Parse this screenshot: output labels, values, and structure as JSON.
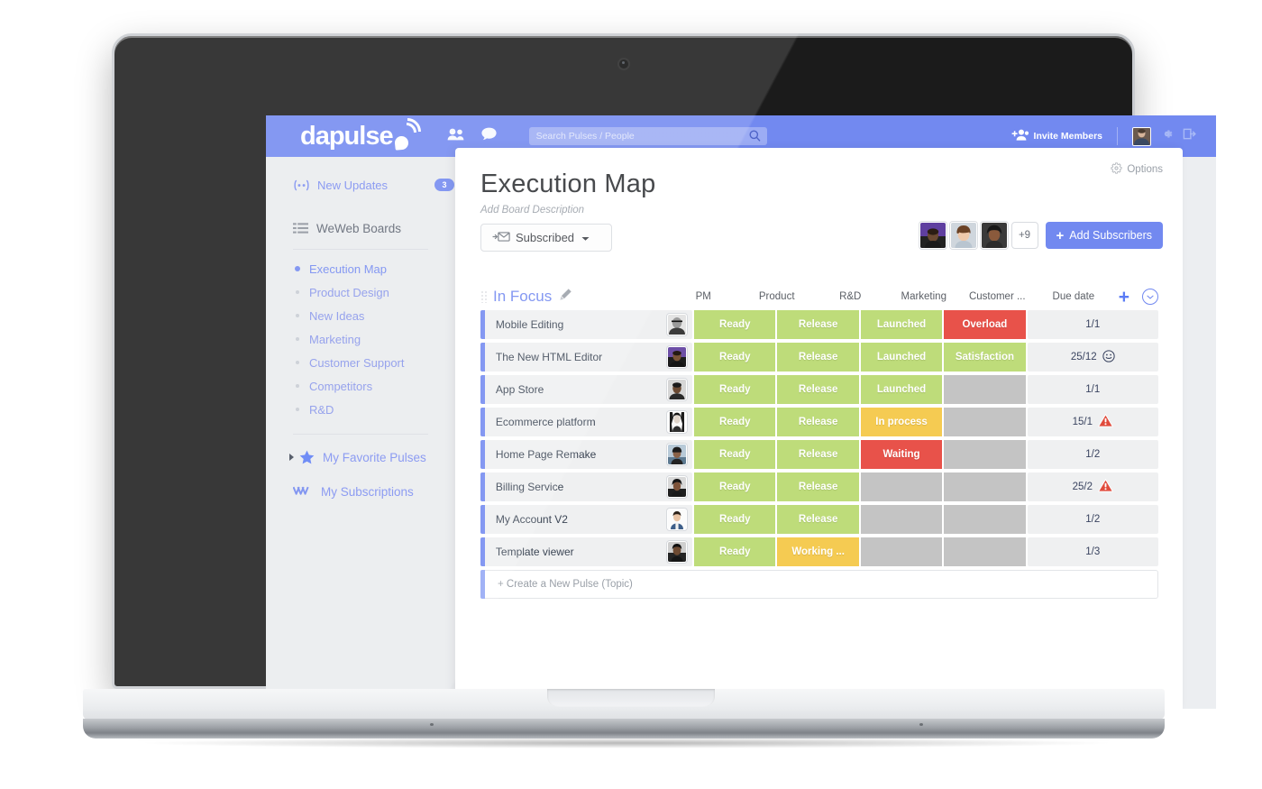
{
  "app": {
    "brand": "dapulse",
    "topbar": {
      "search_placeholder": "Search Pulses / People",
      "invite_label": "Invite Members",
      "icons": [
        "people-icon",
        "chat-icon",
        "search-icon",
        "gear-icon",
        "logout-icon"
      ]
    }
  },
  "sidebar": {
    "new_updates": {
      "label": "New Updates",
      "badge": "3"
    },
    "boards_header": "WeWeb Boards",
    "boards": [
      {
        "label": "Execution Map",
        "active": true
      },
      {
        "label": "Product Design",
        "active": false
      },
      {
        "label": "New Ideas",
        "active": false
      },
      {
        "label": "Marketing",
        "active": false
      },
      {
        "label": "Customer Support",
        "active": false
      },
      {
        "label": "Competitors",
        "active": false
      },
      {
        "label": "R&D",
        "active": false
      }
    ],
    "favorites_label": "My Favorite Pulses",
    "subscriptions_label": "My Subscriptions"
  },
  "board": {
    "options_label": "Options",
    "title": "Execution Map",
    "description_placeholder": "Add Board Description",
    "subscribed_label": "Subscribed",
    "subscriber_overflow": "+9",
    "add_subscribers_label": "Add Subscribers",
    "group_name": "In Focus",
    "new_pulse_label": "+ Create a New Pulse (Topic)",
    "columns": [
      "PM",
      "Product",
      "R&D",
      "Marketing",
      "Customer ...",
      "Due date"
    ],
    "rows": [
      {
        "name": "Mobile Editing",
        "product": "Ready",
        "rd": "Release",
        "marketing": "Launched",
        "customer": "Overload",
        "due": "1/1",
        "due_icon": ""
      },
      {
        "name": "The New HTML Editor",
        "product": "Ready",
        "rd": "Release",
        "marketing": "Launched",
        "customer": "Satisfaction",
        "due": "25/12",
        "due_icon": "smiley-icon"
      },
      {
        "name": "App Store",
        "product": "Ready",
        "rd": "Release",
        "marketing": "Launched",
        "customer": "",
        "due": "1/1",
        "due_icon": ""
      },
      {
        "name": "Ecommerce platform",
        "product": "Ready",
        "rd": "Release",
        "marketing": "In process",
        "customer": "",
        "due": "15/1",
        "due_icon": "warning-icon"
      },
      {
        "name": "Home Page Remake",
        "product": "Ready",
        "rd": "Release",
        "marketing": "Waiting",
        "customer": "",
        "due": "1/2",
        "due_icon": ""
      },
      {
        "name": "Billing Service",
        "product": "Ready",
        "rd": "Release",
        "marketing": "",
        "customer": "",
        "due": "25/2",
        "due_icon": "warning-icon"
      },
      {
        "name": "My Account V2",
        "product": "Ready",
        "rd": "Release",
        "marketing": "",
        "customer": "",
        "due": "1/2",
        "due_icon": ""
      },
      {
        "name": "Template viewer",
        "product": "Ready",
        "rd": "Working ...",
        "marketing": "",
        "customer": "",
        "due": "1/3",
        "due_icon": ""
      }
    ]
  },
  "colors": {
    "brand_blue": "#7289f0",
    "status_green": "#bedc7a",
    "status_red": "#e8524a",
    "status_orange": "#f5cb52",
    "status_empty": "#c4c4c4",
    "cell_grey": "#eff0f1",
    "sidebar_bg": "#e9ebee",
    "warning_red": "#e04b3c"
  }
}
